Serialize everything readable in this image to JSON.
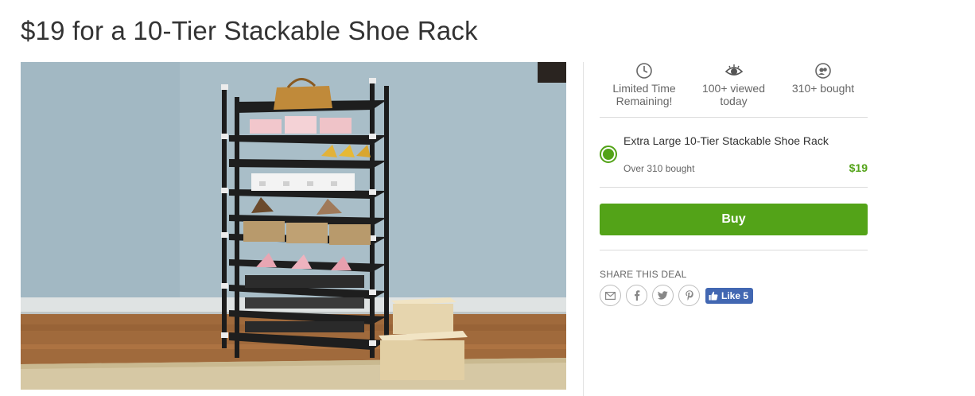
{
  "deal": {
    "title": "$19 for a 10-Tier Stackable Shoe Rack"
  },
  "stats": [
    {
      "icon": "clock-icon",
      "line1": "Limited Time",
      "line2": "Remaining!"
    },
    {
      "icon": "eye-icon",
      "line1": "100+ viewed",
      "line2": "today"
    },
    {
      "icon": "bought-icon",
      "line1": "310+ bought",
      "line2": ""
    }
  ],
  "option": {
    "title": "Extra Large 10-Tier Stackable Shoe Rack",
    "bought": "Over 310 bought",
    "price": "$19",
    "selected": true
  },
  "buy_label": "Buy",
  "share": {
    "label": "SHARE THIS DEAL",
    "buttons": [
      "email-icon",
      "facebook-icon",
      "twitter-icon",
      "pinterest-icon"
    ],
    "like_label": "Like 5"
  },
  "colors": {
    "accent": "#53a318",
    "facebook": "#4267b2"
  }
}
